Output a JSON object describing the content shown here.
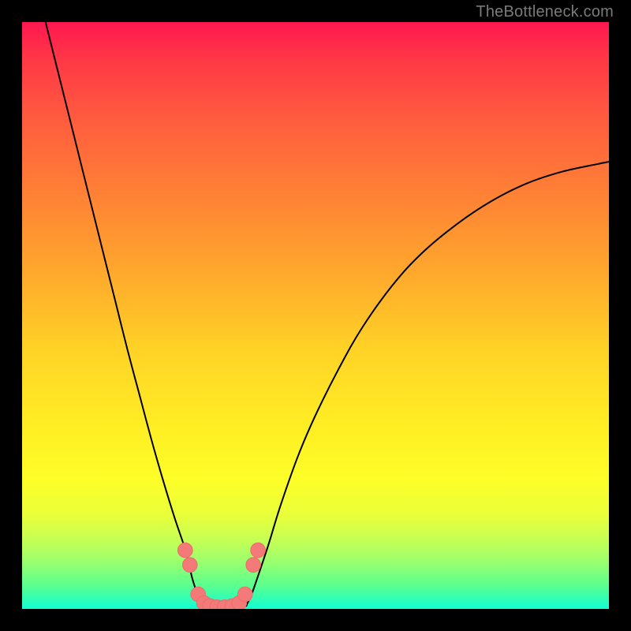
{
  "watermark": "TheBottleneck.com",
  "colors": {
    "frame": "#000000",
    "curve": "#000000",
    "dots": "#f47a7a",
    "gradient_top": "#ff1750",
    "gradient_mid": "#fff024",
    "gradient_bottom": "#10ffd6"
  },
  "chart_data": {
    "type": "line",
    "title": "",
    "xlabel": "",
    "ylabel": "",
    "xlim": [
      0,
      100
    ],
    "ylim": [
      0,
      100
    ],
    "series": [
      {
        "name": "left-branch",
        "x": [
          4,
          6,
          8,
          10,
          12,
          14,
          16,
          18,
          20,
          22,
          24,
          26,
          28,
          29,
          30,
          30.7
        ],
        "y": [
          100,
          92,
          84,
          76,
          68,
          60,
          52,
          44,
          36.5,
          29,
          22,
          15.5,
          9.5,
          5.2,
          2.2,
          0.6
        ]
      },
      {
        "name": "trough",
        "x": [
          30.7,
          31,
          32,
          33,
          34,
          35,
          36,
          37,
          38.2
        ],
        "y": [
          0.6,
          0.1,
          0,
          0,
          0,
          0,
          0,
          0.1,
          0.6
        ]
      },
      {
        "name": "right-branch",
        "x": [
          38.2,
          39,
          40,
          42,
          44,
          47,
          50,
          54,
          58,
          63,
          68,
          74,
          80,
          86,
          92,
          98,
          100
        ],
        "y": [
          0.6,
          2.2,
          5,
          11,
          17.5,
          26,
          33,
          41,
          48,
          55,
          60.5,
          65.5,
          69.5,
          72.5,
          74.5,
          75.8,
          76.2
        ]
      }
    ],
    "markers": [
      {
        "x": 27.8,
        "y": 10
      },
      {
        "x": 28.6,
        "y": 7.5
      },
      {
        "x": 30.0,
        "y": 2.5
      },
      {
        "x": 31.0,
        "y": 1
      },
      {
        "x": 32.0,
        "y": 0.5
      },
      {
        "x": 33.2,
        "y": 0.3
      },
      {
        "x": 34.5,
        "y": 0.3
      },
      {
        "x": 35.8,
        "y": 0.5
      },
      {
        "x": 37.0,
        "y": 1
      },
      {
        "x": 38.0,
        "y": 2.5
      },
      {
        "x": 39.4,
        "y": 7.5
      },
      {
        "x": 40.2,
        "y": 10
      }
    ],
    "marker_radius_pct": 1.25
  }
}
